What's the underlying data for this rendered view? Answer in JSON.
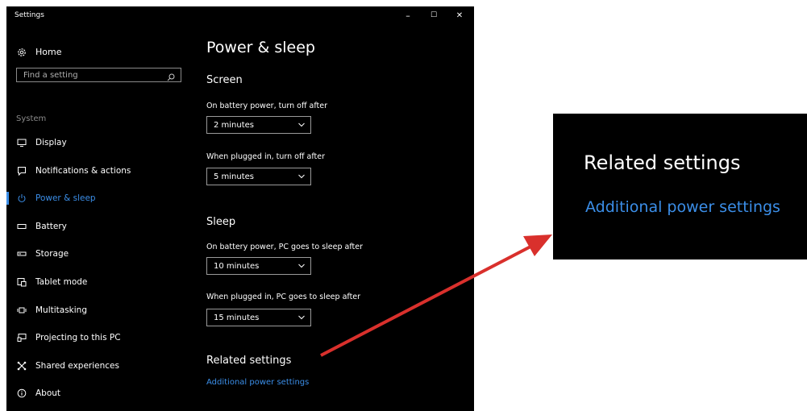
{
  "window": {
    "title": "Settings",
    "minimize_glyph": "–",
    "maximize_glyph": "☐",
    "close_glyph": "✕"
  },
  "nav": {
    "home_label": "Home",
    "search_placeholder": "Find a setting",
    "section_label": "System",
    "items": [
      {
        "label": "Display",
        "icon": "monitor-icon"
      },
      {
        "label": "Notifications & actions",
        "icon": "notification-icon"
      },
      {
        "label": "Power & sleep",
        "icon": "power-icon",
        "active": true
      },
      {
        "label": "Battery",
        "icon": "battery-icon"
      },
      {
        "label": "Storage",
        "icon": "storage-icon"
      },
      {
        "label": "Tablet mode",
        "icon": "tablet-mode-icon"
      },
      {
        "label": "Multitasking",
        "icon": "multitasking-icon"
      },
      {
        "label": "Projecting to this PC",
        "icon": "projecting-icon"
      },
      {
        "label": "Shared experiences",
        "icon": "shared-experiences-icon"
      },
      {
        "label": "About",
        "icon": "info-icon"
      }
    ]
  },
  "content": {
    "title": "Power & sleep",
    "screen": {
      "heading": "Screen",
      "battery_label": "On battery power, turn off after",
      "battery_value": "2 minutes",
      "plugged_label": "When plugged in, turn off after",
      "plugged_value": "5 minutes"
    },
    "sleep": {
      "heading": "Sleep",
      "battery_label": "On battery power, PC goes to sleep after",
      "battery_value": "10 minutes",
      "plugged_label": "When plugged in, PC goes to sleep after",
      "plugged_value": "15 minutes"
    },
    "related": {
      "heading": "Related settings",
      "link": "Additional power settings"
    }
  },
  "callout": {
    "heading": "Related settings",
    "link": "Additional power settings",
    "arrow_color": "#d9302c"
  },
  "colors": {
    "accent": "#3b8ee8",
    "background": "#000000"
  }
}
